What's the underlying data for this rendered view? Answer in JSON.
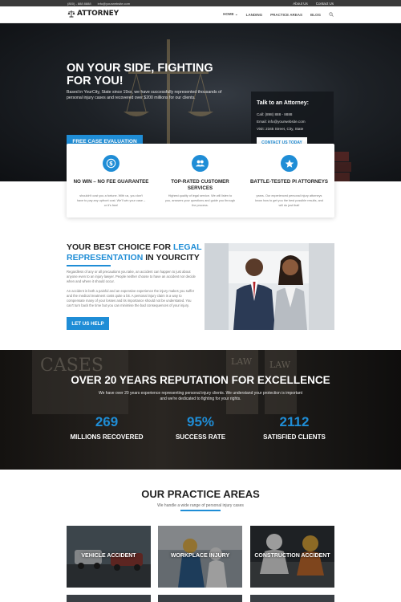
{
  "topbar": {
    "phone": "(800) - 888 8888",
    "email": "info@yourwebsite.com",
    "links": [
      "About Us",
      "Contact Us"
    ]
  },
  "header": {
    "logo_text": "ATTORNEY",
    "nav": [
      "HOME",
      "LANDING",
      "PRACTICE AREAS",
      "BLOG"
    ],
    "home_caret": "⌄"
  },
  "hero": {
    "title": "ON YOUR SIDE, FIGHTING FOR YOU!",
    "lead": "Based in YourCity, State since 19xx, we have successfully represented thousands of personal injury cases and recovered over $200 millions for our clients.",
    "cta": "FREE CASE EVALUATION",
    "contact": {
      "title": "Talk to an Attorney:",
      "call": "Call: (898) 888 - 8888",
      "email": "Email: info@yourwebsite.com",
      "visit": "Visit: 2345 Street, City, State",
      "button": "CONTACT US TODAY"
    }
  },
  "features": [
    {
      "title": "NO WIN – NO FEE GUARANTEE",
      "desc": "shouldn't cost you a fortune. With us, you don't have to pay any upfront cost. We'll win your case – or it's free!",
      "icon": "dollar-icon"
    },
    {
      "title": "TOP-RATED CUSTOMER SERVICES",
      "desc": "Highest quality of legal service. We will listen to you, answers your questions and guide you through the process.",
      "icon": "people-icon"
    },
    {
      "title": "BATTLE-TESTED PI ATTORNEYS",
      "desc": "years. Our experienced personal injury attorneys know how to get you the best possible results, and will do just that!",
      "icon": "star-icon"
    }
  ],
  "best": {
    "title_a": "YOUR BEST CHOICE FOR ",
    "title_hl": "LEGAL REPRESENTATION",
    "title_b": " IN YOURCITY",
    "p1": "Regardless of any or all precautions you take, an accident can happen to just about anyone even to an injury lawyer. People neither choose to have an accident nor decide when and where it should occur.",
    "p2": "An accident is both a painful and an expensive experience the injury makes you suffer and the medical treatment costs quite a bit. A personal injury claim is a way to compensate many of your losses and its importance should not be understated. You can't turn back the time but you can minimise the bad consequences of your injury.",
    "button": "LET US HELP"
  },
  "stats": {
    "title": "OVER 20 YEARS REPUTATION FOR EXCELLENCE",
    "sub": "We have over 20 years experience representing personal injury clients. We understand your protection is important and we're dedicated to fighting for your rights.",
    "items": [
      {
        "value": "269",
        "label": "MILLIONS RECOVERED"
      },
      {
        "value": "95%",
        "label": "SUCCESS RATE"
      },
      {
        "value": "2112",
        "label": "SATISFIED CLIENTS"
      }
    ],
    "book_labels": [
      "CASES",
      "LAW",
      "LAW"
    ]
  },
  "practice": {
    "title": "OUR PRACTICE AREAS",
    "sub": "We handle a wide range of personal injury cases",
    "cards": [
      "VEHICLE ACCIDENT",
      "WORKPLACE INJURY",
      "CONSTRUCTION ACCIDENT"
    ]
  },
  "colors": {
    "accent": "#1f8dd6",
    "dark": "#222222"
  }
}
